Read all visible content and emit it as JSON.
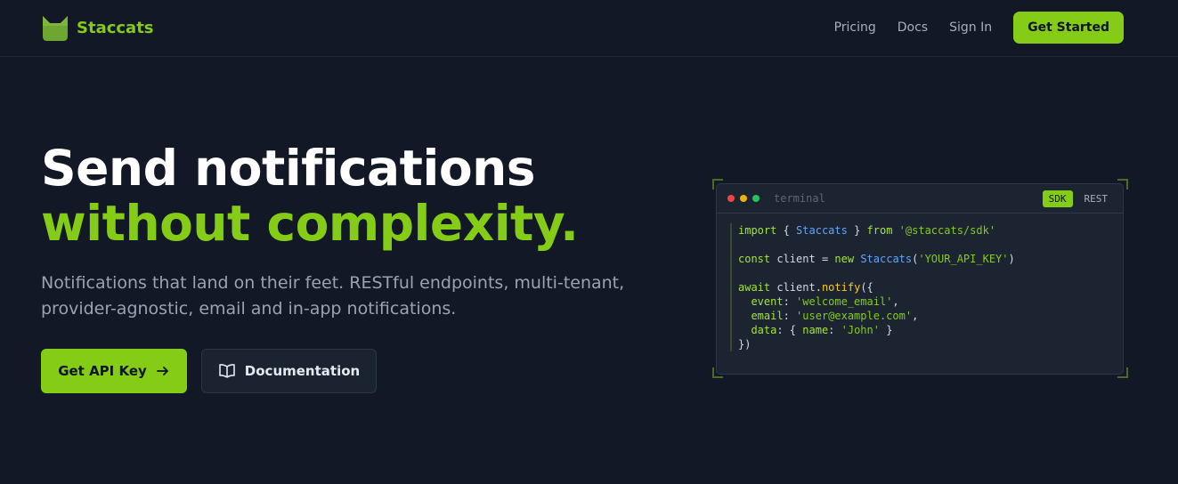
{
  "brand": {
    "name": "Staccats",
    "color": "#84cc16"
  },
  "nav": {
    "links": [
      "Pricing",
      "Docs",
      "Sign In"
    ],
    "cta": "Get Started"
  },
  "hero": {
    "title_line1": "Send notifications",
    "title_line2": "without complexity.",
    "subtitle_line1": "Notifications that land on their feet. RESTful endpoints, multi-tenant,",
    "subtitle_line2": "provider-agnostic, email and in-app notifications.",
    "primary_button": "Get API Key",
    "secondary_button": "Documentation"
  },
  "terminal": {
    "title": "terminal",
    "tabs": [
      "SDK",
      "REST"
    ],
    "active_tab": "SDK",
    "dot_colors": [
      "#ef4444",
      "#eab308",
      "#22c55e"
    ],
    "code": {
      "l1_kw1": "import",
      "l1_p1": " { ",
      "l1_cls": "Staccats",
      "l1_p2": " } ",
      "l1_kw2": "from",
      "l1_str": "'@staccats/sdk'",
      "l2_kw1": "const",
      "l2_var": "client",
      "l2_p1": " = ",
      "l2_kw2": "new",
      "l2_cls": "Staccats",
      "l2_str": "'YOUR_API_KEY'",
      "l3_kw": "await",
      "l3_obj": "client",
      "l3_fn": "notify",
      "l4_prop": "event",
      "l4_str": "'welcome_email'",
      "l5_prop": "email",
      "l5_str": "'user@example.com'",
      "l6_prop": "data",
      "l6_prop2": "name",
      "l6_str": "'John'",
      "l7": "})"
    }
  }
}
